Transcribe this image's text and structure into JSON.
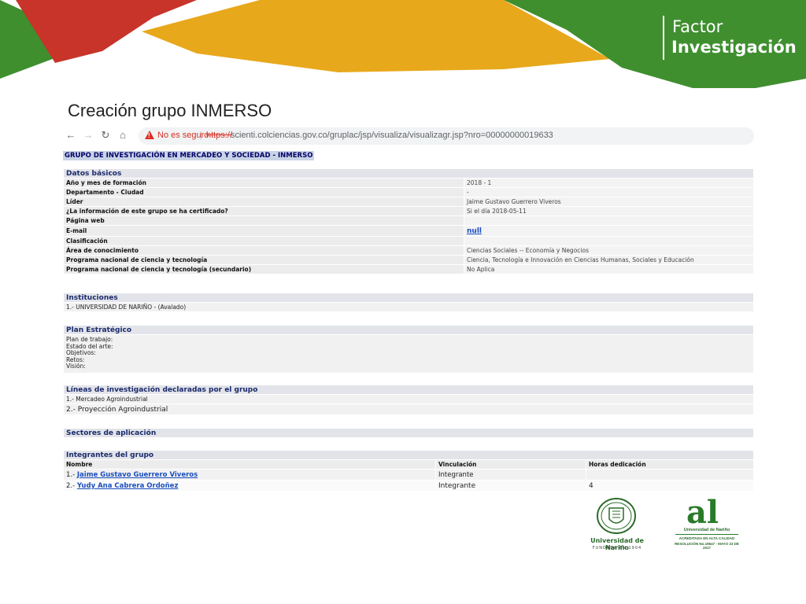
{
  "slide": {
    "brand_line1": "Factor",
    "brand_line2": "Investigación",
    "title": "Creación grupo INMERSO"
  },
  "browser": {
    "security_warning": "No es seguro",
    "url_scheme": "https://",
    "url_rest": "scienti.colciencias.gov.co/gruplac/jsp/visualiza/visualizagr.jsp?nro=00000000019633"
  },
  "page": {
    "group_title": "GRUPO DE INVESTIGACIÓN EN MERCADEO Y SOCIEDAD - INMERSO",
    "datos_basicos": {
      "header": "Datos básicos",
      "rows": [
        {
          "label": "Año y mes de formación",
          "value": "2018 - 1"
        },
        {
          "label": "Departamento - Ciudad",
          "value": "-"
        },
        {
          "label": "Líder",
          "value": "Jaime Gustavo Guerrero Viveros"
        },
        {
          "label": "¿La información de este grupo se ha certificado?",
          "value": "Si el día 2018-05-11"
        },
        {
          "label": "Página web",
          "value": ""
        },
        {
          "label": "E-mail",
          "value": "null"
        },
        {
          "label": "Clasificación",
          "value": ""
        },
        {
          "label": "Área de conocimiento",
          "value": "Ciencias Sociales -- Economía y Negocios"
        },
        {
          "label": "Programa nacional de ciencia y tecnología",
          "value": "Ciencia, Tecnología e Innovación en Ciencias Humanas, Sociales y Educación"
        },
        {
          "label": "Programa nacional de ciencia y tecnología (secundario)",
          "value": "No Aplica"
        }
      ]
    },
    "instituciones": {
      "header": "Instituciones",
      "items": [
        "1.- UNIVERSIDAD DE NARIÑO - (Avalado)"
      ]
    },
    "plan": {
      "header": "Plan Estratégico",
      "lines": [
        "Plan de trabajo:",
        "Estado del arte:",
        "Objetivos:",
        "Retos:",
        "Visión:"
      ]
    },
    "lineas": {
      "header": "Líneas de investigación declaradas por el grupo",
      "items": [
        "1.- Mercadeo Agroindustrial",
        "2.- Proyección Agroindustrial"
      ]
    },
    "sectores": {
      "header": "Sectores de aplicación"
    },
    "integrantes": {
      "header": "Integrantes del grupo",
      "columns": [
        "Nombre",
        "Vinculación",
        "Horas dedicación"
      ],
      "rows": [
        {
          "num": "1.-",
          "name": "Jaime Gustavo Guerrero Viveros",
          "vinculacion": "Integrante",
          "horas": ""
        },
        {
          "num": "2.-",
          "name": "Yudy Ana Cabrera Ordoñez",
          "vinculacion": "Integrante",
          "horas": "4"
        }
      ]
    }
  },
  "logos": {
    "udenar_name": "Universidad de Nariño",
    "udenar_sub": "FUNDADA EN 1904",
    "al_mark": "al",
    "al_name": "Universidad de Nariño",
    "al_text1": "ACREDITADA EN ALTA CALIDAD",
    "al_text2": "RESOLUCIÓN No.19547 - MAYO 23 DE 2017"
  },
  "colors": {
    "green": "#3f8f2f",
    "yellow": "#e8a81b",
    "red": "#c8342a",
    "link": "#1a4fbf",
    "section_text": "#1b2a6b"
  }
}
